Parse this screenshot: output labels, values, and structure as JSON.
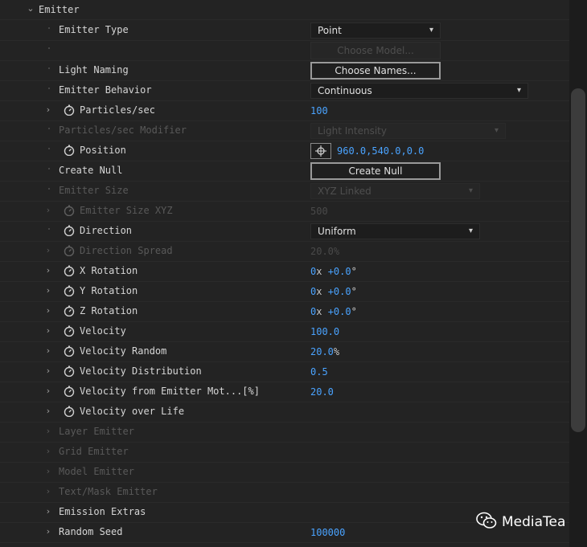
{
  "section": {
    "title": "Emitter"
  },
  "rows": {
    "emitter_type": {
      "label": "Emitter Type",
      "value": "Point"
    },
    "choose_model": {
      "value": "Choose Model..."
    },
    "light_naming": {
      "label": "Light Naming",
      "value": "Choose Names..."
    },
    "emitter_behavior": {
      "label": "Emitter Behavior",
      "value": "Continuous"
    },
    "particles_sec": {
      "label": "Particles/sec",
      "value": "100"
    },
    "particles_sec_modifier": {
      "label": "Particles/sec Modifier",
      "value": "Light Intensity"
    },
    "position": {
      "label": "Position",
      "value": "960.0,540.0,0.0"
    },
    "create_null": {
      "label": "Create Null",
      "value": "Create Null"
    },
    "emitter_size": {
      "label": "Emitter Size",
      "value": "XYZ Linked"
    },
    "emitter_size_xyz": {
      "label": "Emitter Size XYZ",
      "value": "500"
    },
    "direction": {
      "label": "Direction",
      "value": "Uniform"
    },
    "direction_spread": {
      "label": "Direction Spread",
      "value": "20.0",
      "unit": "%"
    },
    "x_rotation": {
      "label": "X Rotation",
      "rev": "0",
      "x": "x",
      "deg": "+0.0",
      "deg_unit": "°"
    },
    "y_rotation": {
      "label": "Y Rotation",
      "rev": "0",
      "x": "x",
      "deg": "+0.0",
      "deg_unit": "°"
    },
    "z_rotation": {
      "label": "Z Rotation",
      "rev": "0",
      "x": "x",
      "deg": "+0.0",
      "deg_unit": "°"
    },
    "velocity": {
      "label": "Velocity",
      "value": "100.0"
    },
    "velocity_random": {
      "label": "Velocity Random",
      "value": "20.0",
      "unit": "%"
    },
    "velocity_distribution": {
      "label": "Velocity Distribution",
      "value": "0.5"
    },
    "velocity_from_emitter": {
      "label": "Velocity from Emitter Mot...[%]",
      "value": "20.0"
    },
    "velocity_over_life": {
      "label": "Velocity over Life"
    },
    "layer_emitter": {
      "label": "Layer Emitter"
    },
    "grid_emitter": {
      "label": "Grid Emitter"
    },
    "model_emitter": {
      "label": "Model Emitter"
    },
    "text_mask_emitter": {
      "label": "Text/Mask Emitter"
    },
    "emission_extras": {
      "label": "Emission Extras"
    },
    "random_seed": {
      "label": "Random Seed",
      "value": "100000"
    }
  },
  "watermark": {
    "text": "MediaTea",
    "icon": "wechat-icon"
  },
  "colors": {
    "value_blue": "#4aa3ff",
    "background": "#232323",
    "disabled": "#595959"
  }
}
